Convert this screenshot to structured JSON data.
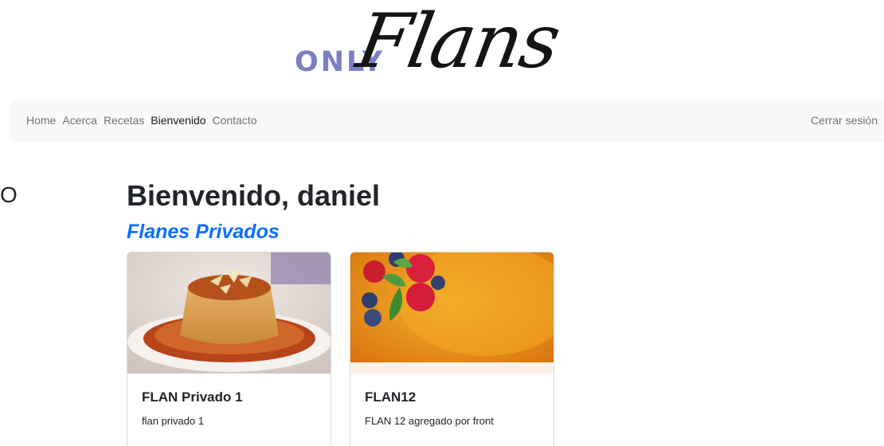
{
  "logo": {
    "only": "ONLY",
    "flans": "Flans"
  },
  "navbar": {
    "links": [
      {
        "label": "Home",
        "active": false
      },
      {
        "label": "Acerca",
        "active": false
      },
      {
        "label": "Recetas",
        "active": false
      },
      {
        "label": "Bienvenido",
        "active": true
      },
      {
        "label": "Contacto",
        "active": false
      }
    ],
    "logout": "Cerrar sesión"
  },
  "stray_glyph": "O",
  "main": {
    "welcome": "Bienvenido, daniel",
    "subtitle": "Flanes Privados"
  },
  "cards": [
    {
      "title": "FLAN Privado 1",
      "text": "flan privado 1"
    },
    {
      "title": "FLAN12",
      "text": "FLAN 12 agregado por front"
    }
  ],
  "colors": {
    "accent": "#0d6efd",
    "logo_only": "#7b7fc3",
    "navbar_bg": "#f8f9fa"
  }
}
